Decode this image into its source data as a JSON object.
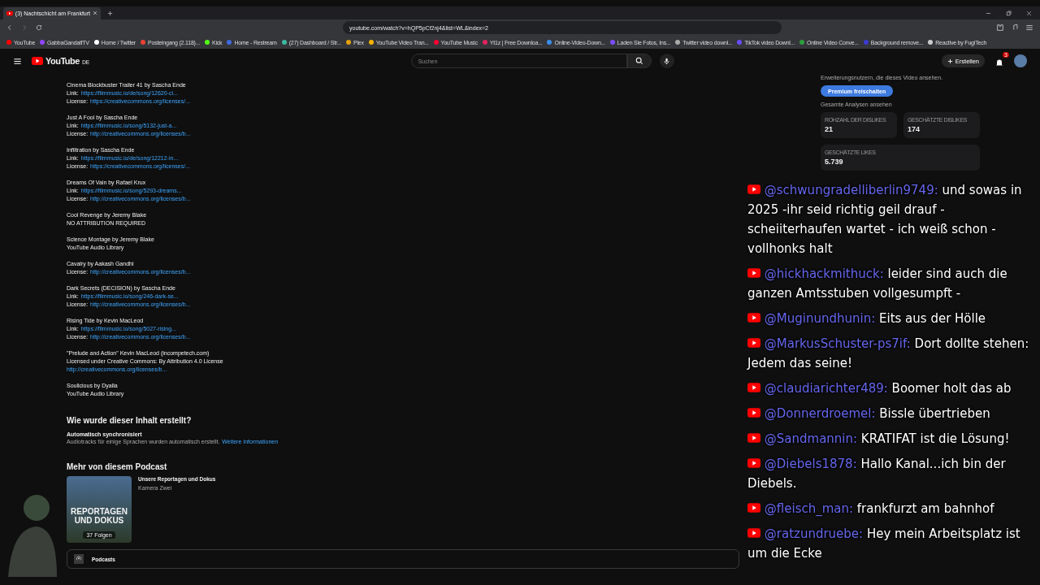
{
  "browser": {
    "tab": {
      "title": "(3) Nachtschicht am Frankfurt",
      "selected": true
    },
    "address": "youtube.com/watch?v=hQP5pCf2nj4&list=WL&index=2",
    "bookmarks": [
      "YouTube",
      "GabbaGandalfTV",
      "Home / Twitter",
      "Posteingang (2.118)...",
      "Kick",
      "Home - Restream",
      "(27) Dashboard / Str...",
      "Plex",
      "YouTube Video Tran...",
      "YouTube Music",
      "Yt1z | Free Downloa...",
      "Online-Video-Down...",
      "Laden Sie Fotos, Ins...",
      "Twitter video downl...",
      "TikTok video Downl...",
      "Online Video Conve...",
      "Background remove...",
      "Reactive by FugiTech"
    ]
  },
  "header": {
    "logo": "YouTube",
    "region": "DE",
    "search_placeholder": "Suchen",
    "create": "Erstellen",
    "notifications": "3"
  },
  "tracks": [
    {
      "title": "Cinema Blockbuster Trailer 41 by Sascha Ende",
      "lines": [
        {
          "kind": "link",
          "label": "Link:",
          "url": "https://filmmusic.io/de/song/12620-ci..."
        },
        {
          "kind": "link",
          "label": "License:",
          "url": "https://creativecommons.org/licenses/..."
        }
      ]
    },
    {
      "title": "Just A Fool by Sascha Ende",
      "lines": [
        {
          "kind": "link",
          "label": "Link:",
          "url": "https://filmmusic.io/song/5132-just-a..."
        },
        {
          "kind": "link",
          "label": "License:",
          "url": "http://creativecommons.org/licenses/b..."
        }
      ]
    },
    {
      "title": "Infiltration by Sascha Ende",
      "lines": [
        {
          "kind": "link",
          "label": "Link:",
          "url": "https://filmmusic.io/de/song/12212-in..."
        },
        {
          "kind": "link",
          "label": "License:",
          "url": "https://creativecommons.org/licenses/..."
        }
      ]
    },
    {
      "title": "Dreams Of Vain by Rafael Krux",
      "lines": [
        {
          "kind": "link",
          "label": "Link:",
          "url": "https://filmmusic.io/song/5293-dreams..."
        },
        {
          "kind": "link",
          "label": "License:",
          "url": "http://creativecommons.org/licenses/b..."
        }
      ]
    },
    {
      "title": "Cool Revenge by Jeremy Blake",
      "lines": [
        {
          "kind": "text",
          "text": "NO ATTRIBUTION REQUIRED"
        }
      ]
    },
    {
      "title": "Science Montage by Jeremy Blake",
      "lines": [
        {
          "kind": "text",
          "text": "YouTube Audio Library"
        }
      ]
    },
    {
      "title": "Cavalry by Aakash Gandhi",
      "lines": [
        {
          "kind": "link",
          "label": "License:",
          "url": "http://creativecommons.org/licenses/b..."
        }
      ]
    },
    {
      "title": "Dark Secrets (DECISION) by Sascha Ende",
      "lines": [
        {
          "kind": "link",
          "label": "Link:",
          "url": "https://filmmusic.io/song/246-dark-se..."
        },
        {
          "kind": "link",
          "label": "License:",
          "url": "http://creativecommons.org/licenses/b..."
        }
      ]
    },
    {
      "title": "Rising Tide by Kevin MacLeod",
      "lines": [
        {
          "kind": "link",
          "label": "Link:",
          "url": "https://filmmusic.io/song/5027-rising..."
        },
        {
          "kind": "link",
          "label": "License:",
          "url": "http://creativecommons.org/licenses/b..."
        }
      ]
    },
    {
      "title": "\"Prelude and Action\" Kevin MacLeod (incompetech.com)",
      "lines": [
        {
          "kind": "text",
          "text": "Licensed under Creative Commons: By Attribution 4.0 License"
        },
        {
          "kind": "url",
          "url": "http://creativecommons.org/licenses/b..."
        }
      ]
    },
    {
      "title": "Soulicious by Dyalla",
      "lines": [
        {
          "kind": "text",
          "text": "YouTube Audio Library"
        }
      ]
    }
  ],
  "creation": {
    "heading": "Wie wurde dieser Inhalt erstellt?",
    "subheading": "Automatisch synchronisiert",
    "text": "Audiotracks für einige Sprachen wurden automatisch erstellt.",
    "link": "Weitere Informationen"
  },
  "podcast": {
    "heading": "Mehr von diesem Podcast",
    "cover_title": "REPORTAGEN UND DOKUS",
    "episodes": "37 Folgen",
    "title": "Unsere Reportagen und Dokus",
    "channel": "Kamera Zwei",
    "footer": "Podcasts"
  },
  "stats": {
    "intro": "Erweiterungsnutzern, die dieses Video ansehen.",
    "premium_button": "Premium freischalten",
    "analysis_link": "Gesamte Analysen ansehen",
    "cards": [
      {
        "label": "ROHZAHL DER DISLIKES",
        "value": "21"
      },
      {
        "label": "GESCHÄTZTE DISLIKES",
        "value": "174"
      },
      {
        "label": "GESCHÄTZTE LIKES",
        "value": "5.739"
      }
    ]
  },
  "chat": [
    {
      "user": "@schwungradelliberlin9749:",
      "text": "und sowas in 2025 -ihr seid richtig geil drauf - scheiiterhaufen wartet - ich weiß schon - vollhonks halt"
    },
    {
      "user": "@hickhackmithuck:",
      "text": "leider sind auch die ganzen Amtsstuben vollgesumpft -"
    },
    {
      "user": "@Muginundhunin:",
      "text": "Eits aus der Hölle"
    },
    {
      "user": "@MarkusSchuster-ps7if:",
      "text": "Dort dollte stehen: Jedem das seine!"
    },
    {
      "user": "@claudiarichter489:",
      "text": "Boomer holt das ab"
    },
    {
      "user": "@Donnerdroemel:",
      "text": "Bissle übertrieben"
    },
    {
      "user": "@Sandmannin:",
      "text": "KRATIFAT ist die Lösung!"
    },
    {
      "user": "@Diebels1878:",
      "text": "Hallo Kanal...ich bin der Diebels."
    },
    {
      "user": "@fleisch_man:",
      "text": "frankfurzt am bahnhof"
    },
    {
      "user": "@ratzundruebe:",
      "text": "Hey mein Arbeitsplatz ist um die Ecke"
    }
  ]
}
